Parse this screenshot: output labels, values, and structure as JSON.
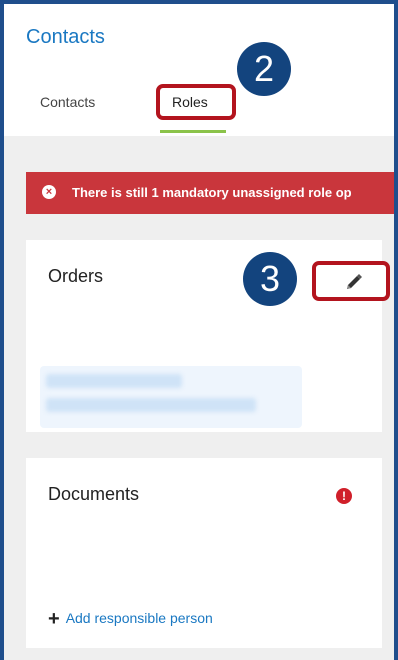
{
  "header": {
    "title": "Contacts"
  },
  "tabs": [
    {
      "label": "Contacts"
    },
    {
      "label": "Roles"
    }
  ],
  "alert": {
    "text": "There is still 1 mandatory unassigned role op",
    "icon": "close-circle-icon"
  },
  "cards": {
    "orders": {
      "title": "Orders",
      "edit_icon": "pencil-icon"
    },
    "documents": {
      "title": "Documents",
      "warning_icon": "exclamation-circle-icon",
      "warning_glyph": "!",
      "add_label": "Add responsible person",
      "add_glyph": "+"
    }
  },
  "callouts": [
    {
      "label": "2"
    },
    {
      "label": "3"
    }
  ],
  "colors": {
    "accent": "#1a78c2",
    "alert": "#c9363c",
    "tab_underline": "#8bc34a",
    "callout": "#13447e",
    "highlight": "#b3141e"
  }
}
